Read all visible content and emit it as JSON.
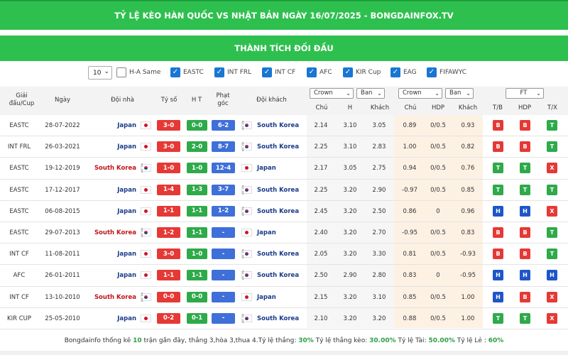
{
  "page": {
    "banner_title": "TỶ LỆ KÈO HÀN QUỐC VS NHẬT BẢN NGÀY 16/07/2025 - BONGDAINFOX.TV",
    "section_title": "THÀNH TÍCH ĐỐI ĐẦU"
  },
  "filters": {
    "count_value": "10",
    "items": [
      {
        "label": "H-A Same",
        "checked": false
      },
      {
        "label": "EASTC",
        "checked": true
      },
      {
        "label": "INT FRL",
        "checked": true
      },
      {
        "label": "INT CF",
        "checked": true
      },
      {
        "label": "AFC",
        "checked": true
      },
      {
        "label": "KIR Cup",
        "checked": true
      },
      {
        "label": "EAG",
        "checked": true
      },
      {
        "label": "FIFAWYC",
        "checked": true
      }
    ]
  },
  "headers": {
    "league": "Giải\nđấu/Cup",
    "date": "Ngày",
    "home": "Đội nhà",
    "score": "Tỷ số",
    "ht": "H T",
    "corner": "Phạt\ngóc",
    "away": "Đội khách",
    "ddl_crown_1": "Crown",
    "ddl_ban_1": "Ban",
    "ddl_crown_2": "Crown",
    "ddl_ban_2": "Ban",
    "ddl_ft": "FT",
    "odds_cols_1": [
      "Chủ",
      "H",
      "Khách"
    ],
    "odds_cols_2": [
      "Chủ",
      "HDP",
      "Khách"
    ],
    "result_cols": [
      "T/B",
      "HDP",
      "T/X"
    ]
  },
  "rows": [
    {
      "league": "EASTC",
      "date": "28-07-2022",
      "home": "Japan",
      "home_flag": "jp",
      "away": "South Korea",
      "away_flag": "kr",
      "hl": "away",
      "score": "3-0",
      "ht": "0-0",
      "corner": "6-2",
      "o1": [
        "2.14",
        "3.10",
        "3.05"
      ],
      "o2": [
        "0.89",
        "0/0.5",
        "0.93"
      ],
      "res": [
        "B",
        "B",
        "T"
      ]
    },
    {
      "league": "INT FRL",
      "date": "26-03-2021",
      "home": "Japan",
      "home_flag": "jp",
      "away": "South Korea",
      "away_flag": "kr",
      "hl": "away",
      "score": "3-0",
      "ht": "2-0",
      "corner": "8-7",
      "o1": [
        "2.25",
        "3.10",
        "2.83"
      ],
      "o2": [
        "1.00",
        "0/0.5",
        "0.82"
      ],
      "res": [
        "B",
        "B",
        "T"
      ]
    },
    {
      "league": "EASTC",
      "date": "19-12-2019",
      "home": "South Korea",
      "home_flag": "kr",
      "away": "Japan",
      "away_flag": "jp",
      "hl": "home",
      "score": "1-0",
      "ht": "1-0",
      "corner": "12-4",
      "o1": [
        "2.17",
        "3.05",
        "2.75"
      ],
      "o2": [
        "0.94",
        "0/0.5",
        "0.76"
      ],
      "res": [
        "T",
        "T",
        "X"
      ]
    },
    {
      "league": "EASTC",
      "date": "17-12-2017",
      "home": "Japan",
      "home_flag": "jp",
      "away": "South Korea",
      "away_flag": "kr",
      "hl": "away",
      "score": "1-4",
      "ht": "1-3",
      "corner": "3-7",
      "o1": [
        "2.25",
        "3.20",
        "2.90"
      ],
      "o2": [
        "-0.97",
        "0/0.5",
        "0.85"
      ],
      "res": [
        "T",
        "T",
        "T"
      ]
    },
    {
      "league": "EASTC",
      "date": "06-08-2015",
      "home": "Japan",
      "home_flag": "jp",
      "away": "South Korea",
      "away_flag": "kr",
      "hl": "away",
      "score": "1-1",
      "ht": "1-1",
      "corner": "1-2",
      "o1": [
        "2.45",
        "3.20",
        "2.50"
      ],
      "o2": [
        "0.86",
        "0",
        "0.96"
      ],
      "res": [
        "H",
        "H",
        "X"
      ]
    },
    {
      "league": "EASTC",
      "date": "29-07-2013",
      "home": "South Korea",
      "home_flag": "kr",
      "away": "Japan",
      "away_flag": "jp",
      "hl": "home",
      "score": "1-2",
      "ht": "1-1",
      "corner": "-",
      "o1": [
        "2.40",
        "3.20",
        "2.70"
      ],
      "o2": [
        "-0.95",
        "0/0.5",
        "0.83"
      ],
      "res": [
        "B",
        "B",
        "T"
      ]
    },
    {
      "league": "INT CF",
      "date": "11-08-2011",
      "home": "Japan",
      "home_flag": "jp",
      "away": "South Korea",
      "away_flag": "kr",
      "hl": "away",
      "score": "3-0",
      "ht": "1-0",
      "corner": "-",
      "o1": [
        "2.05",
        "3.20",
        "3.30"
      ],
      "o2": [
        "0.81",
        "0/0.5",
        "-0.93"
      ],
      "res": [
        "B",
        "B",
        "T"
      ]
    },
    {
      "league": "AFC",
      "date": "26-01-2011",
      "home": "Japan",
      "home_flag": "jp",
      "away": "South Korea",
      "away_flag": "kr",
      "hl": "away",
      "score": "1-1",
      "ht": "1-1",
      "corner": "-",
      "o1": [
        "2.50",
        "2.90",
        "2.80"
      ],
      "o2": [
        "0.83",
        "0",
        "-0.95"
      ],
      "res": [
        "H",
        "H",
        "H"
      ]
    },
    {
      "league": "INT CF",
      "date": "13-10-2010",
      "home": "South Korea",
      "home_flag": "kr",
      "away": "Japan",
      "away_flag": "jp",
      "hl": "home",
      "score": "0-0",
      "ht": "0-0",
      "corner": "-",
      "o1": [
        "2.15",
        "3.20",
        "3.10"
      ],
      "o2": [
        "0.85",
        "0/0.5",
        "1.00"
      ],
      "res": [
        "H",
        "B",
        "X"
      ]
    },
    {
      "league": "KIR CUP",
      "date": "25-05-2010",
      "home": "Japan",
      "home_flag": "jp",
      "away": "South Korea",
      "away_flag": "kr",
      "hl": "away",
      "score": "0-2",
      "ht": "0-1",
      "corner": "-",
      "o1": [
        "2.10",
        "3.20",
        "3.20"
      ],
      "o2": [
        "0.88",
        "0/0.5",
        "1.00"
      ],
      "res": [
        "T",
        "T",
        "X"
      ]
    }
  ],
  "colors": {
    "score": "#e53935",
    "ht": "#2eaa4a",
    "corner": "#3f6fd8",
    "res_B": "#e53935",
    "res_T": "#2eaa4a",
    "res_H": "#1e56c8",
    "res_X": "#e53935"
  },
  "footer": {
    "t1": "Bongdainfo thống kê",
    "count": "10",
    "t2": "trận gần đây, thắng 3,hòa 3,thua 4.Tỷ lệ thắng:",
    "win_rate": "30%",
    "t3": "Tỷ lệ thắng kèo:",
    "hdp_rate": "30.00%",
    "t4": "Tỷ lệ Tài:",
    "over_rate": "50.00%",
    "t5": "Tỷ lệ Lẻ :",
    "odd_rate": "60%"
  }
}
